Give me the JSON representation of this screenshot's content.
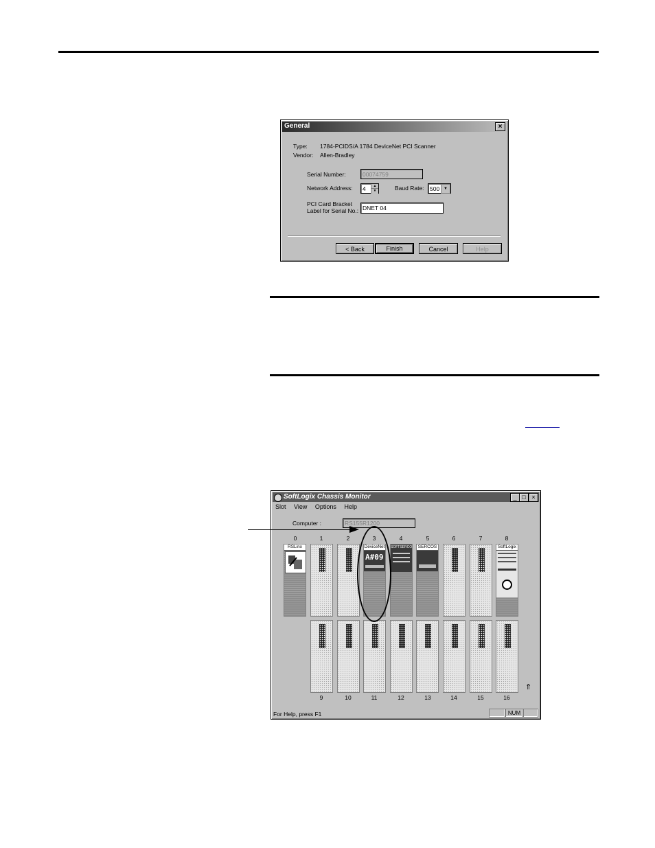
{
  "general_dialog": {
    "title": "General",
    "close_glyph": "×",
    "type_label": "Type:",
    "type_value": "1784-PCIDS/A 1784 DeviceNet PCI Scanner",
    "vendor_label": "Vendor:",
    "vendor_value": "Allen-Bradley",
    "serial_label": "Serial Number:",
    "serial_value": "00074759",
    "network_label": "Network Address:",
    "network_value": "4",
    "baud_label": "Baud Rate:",
    "baud_value": "500",
    "bracket_label_line1": "PCI Card Bracket",
    "bracket_label_line2": "Label for Serial No.:",
    "bracket_value": "DNET 04",
    "buttons": {
      "back": "< Back",
      "finish": "Finish",
      "cancel": "Cancel",
      "help": "Help"
    }
  },
  "chassis_monitor": {
    "title": "SoftLogix Chassis Monitor",
    "menu": [
      "Slot",
      "View",
      "Options",
      "Help"
    ],
    "computer_label": "Computer :",
    "computer_value": "RS155R1200",
    "top_slot_numbers": [
      "0",
      "1",
      "2",
      "3",
      "4",
      "5",
      "6",
      "7",
      "8"
    ],
    "bottom_slot_numbers": [
      "9",
      "10",
      "11",
      "12",
      "13",
      "14",
      "15",
      "16"
    ],
    "modules": {
      "rslinx": "RSLinx",
      "devicenet": "DeviceNet",
      "devicenet_display": "A#09",
      "slot4": "SOFTSERCOS",
      "slot5": "SERCOS",
      "softlogix": "SoftLogix"
    },
    "status_text": "For Help, press F1",
    "num_indicator": "NUM"
  }
}
